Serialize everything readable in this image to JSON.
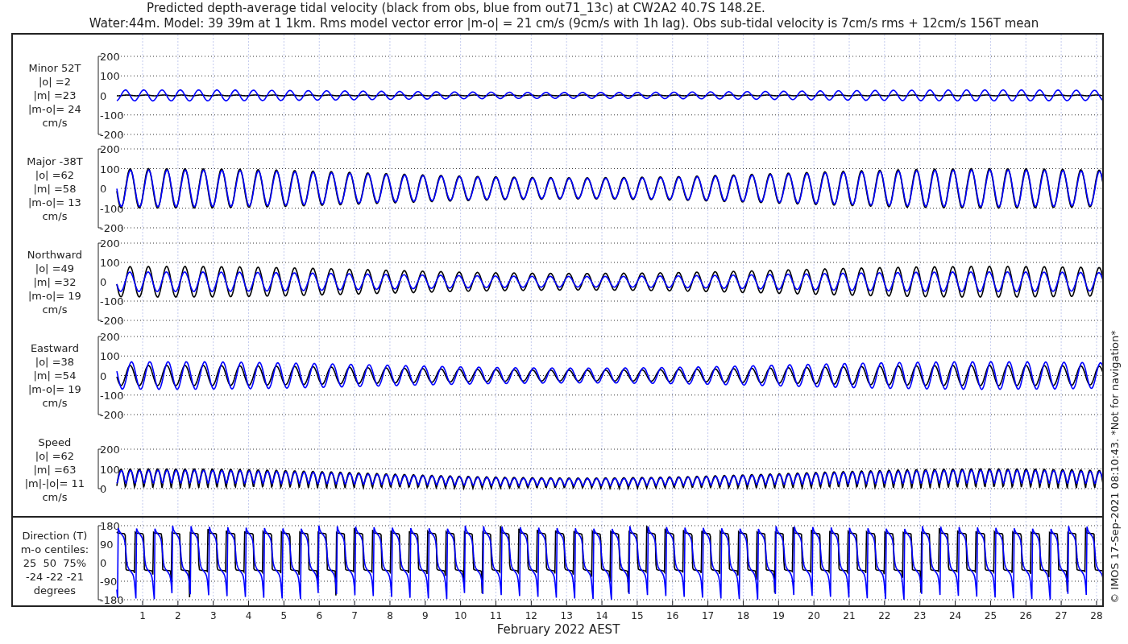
{
  "title": [
    "Predicted depth-average tidal velocity (black from obs, blue from out71_13c) at CW2A2 40.7S 148.2E.",
    "Water:44m. Model: 39 39m at 1 1km. Rms model vector error |m-o| = 21 cm/s (9cm/s with 1h lag). Obs sub-tidal velocity is 7cm/s rms + 12cm/s 156T mean"
  ],
  "panels": [
    {
      "kind": "minor",
      "label_lines": [
        "Minor 52T",
        "|o| =2",
        "|m| =23",
        "|m-o|= 24",
        "cm/s"
      ],
      "yticks": [
        "200",
        "100",
        "0",
        "-100",
        "-200"
      ]
    },
    {
      "kind": "major",
      "label_lines": [
        "Major -38T",
        "|o| =62",
        "|m| =58",
        "|m-o|= 13",
        "cm/s"
      ],
      "yticks": [
        "200",
        "100",
        "0",
        "-100",
        "-200"
      ]
    },
    {
      "kind": "northward",
      "label_lines": [
        "Northward",
        "|o| =49",
        "|m| =32",
        "|m-o|= 19",
        "cm/s"
      ],
      "yticks": [
        "200",
        "100",
        "0",
        "-100",
        "-200"
      ]
    },
    {
      "kind": "eastward",
      "label_lines": [
        "Eastward",
        "|o| =38",
        "|m| =54",
        "|m-o|= 19",
        "cm/s"
      ],
      "yticks": [
        "200",
        "100",
        "0",
        "-100",
        "-200"
      ]
    },
    {
      "kind": "speed",
      "label_lines": [
        "Speed",
        "|o| =62",
        "|m| =63",
        "|m|-|o|= 11",
        "cm/s"
      ],
      "yticks": [
        "200",
        "100",
        "0"
      ]
    },
    {
      "kind": "direction",
      "label_lines": [
        "Direction (T)",
        "m-o centiles:",
        "25  50  75%",
        "-24 -22 -21",
        "degrees"
      ],
      "yticks": [
        "180",
        "90",
        "0",
        "-90",
        "-180"
      ]
    }
  ],
  "x_axis": {
    "ticks": [
      "1",
      "2",
      "3",
      "4",
      "5",
      "6",
      "7",
      "8",
      "9",
      "10",
      "11",
      "12",
      "13",
      "14",
      "15",
      "16",
      "17",
      "18",
      "19",
      "20",
      "21",
      "22",
      "23",
      "24",
      "25",
      "26",
      "27",
      "28"
    ],
    "label": "February 2022 AEST"
  },
  "footer_note": "© IMOS 17-Sep-2021 08:10:43. *Not for navigation*"
}
